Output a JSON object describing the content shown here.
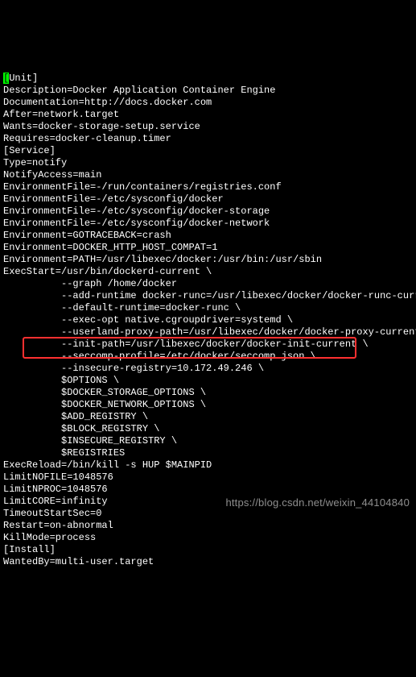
{
  "terminal": {
    "lines": [
      "[Unit]",
      "Description=Docker Application Container Engine",
      "Documentation=http://docs.docker.com",
      "After=network.target",
      "Wants=docker-storage-setup.service",
      "Requires=docker-cleanup.timer",
      "",
      "[Service]",
      "Type=notify",
      "NotifyAccess=main",
      "EnvironmentFile=-/run/containers/registries.conf",
      "EnvironmentFile=-/etc/sysconfig/docker",
      "EnvironmentFile=-/etc/sysconfig/docker-storage",
      "EnvironmentFile=-/etc/sysconfig/docker-network",
      "Environment=GOTRACEBACK=crash",
      "Environment=DOCKER_HTTP_HOST_COMPAT=1",
      "Environment=PATH=/usr/libexec/docker:/usr/bin:/usr/sbin",
      "ExecStart=/usr/bin/dockerd-current \\",
      "          --graph /home/docker",
      "          --add-runtime docker-runc=/usr/libexec/docker/docker-runc-current \\",
      "          --default-runtime=docker-runc \\",
      "          --exec-opt native.cgroupdriver=systemd \\",
      "          --userland-proxy-path=/usr/libexec/docker/docker-proxy-current \\",
      "          --init-path=/usr/libexec/docker/docker-init-current \\",
      "          --seccomp-profile=/etc/docker/seccomp.json \\",
      "          --insecure-registry=10.172.49.246 \\",
      "          $OPTIONS \\",
      "          $DOCKER_STORAGE_OPTIONS \\",
      "          $DOCKER_NETWORK_OPTIONS \\",
      "          $ADD_REGISTRY \\",
      "          $BLOCK_REGISTRY \\",
      "          $INSECURE_REGISTRY \\",
      "          $REGISTRIES",
      "ExecReload=/bin/kill -s HUP $MAINPID",
      "LimitNOFILE=1048576",
      "LimitNPROC=1048576",
      "LimitCORE=infinity",
      "TimeoutStartSec=0",
      "Restart=on-abnormal",
      "KillMode=process",
      "",
      "[Install]",
      "WantedBy=multi-user.target"
    ],
    "cursor_line_index": 0,
    "cursor_char": "[",
    "cursor_rest": "Unit]"
  },
  "highlight": {
    "target_line_index": 25,
    "color": "#ff3030"
  },
  "watermark": {
    "text": "https://blog.csdn.net/weixin_44104840"
  }
}
